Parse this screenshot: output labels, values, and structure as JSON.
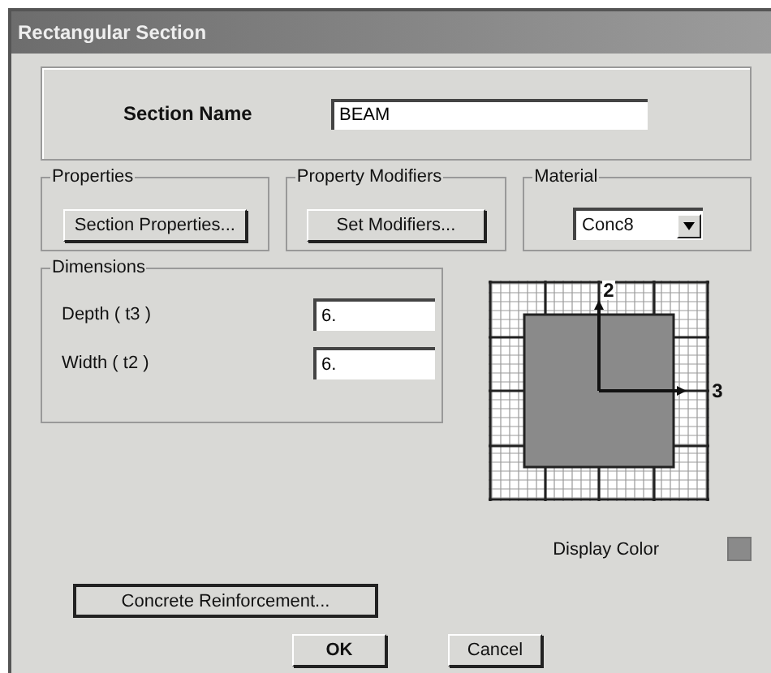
{
  "window": {
    "title": "Rectangular Section"
  },
  "section_name": {
    "label": "Section Name",
    "value": "BEAM"
  },
  "groups": [
    {
      "title": "Properties",
      "button": "Section Properties..."
    },
    {
      "title": "Property Modifiers",
      "button": "Set Modifiers..."
    }
  ],
  "material": {
    "title": "Material",
    "value": "Conc8"
  },
  "dimensions": {
    "title": "Dimensions",
    "fields": [
      {
        "label": "Depth ( t3 )",
        "value": "6."
      },
      {
        "label": "Width ( t2 )",
        "value": "6."
      }
    ]
  },
  "preview": {
    "axis_vertical": "2",
    "axis_horizontal": "3"
  },
  "display_color": {
    "label": "Display Color",
    "color": "#8a8a8a"
  },
  "reinforcement_button": "Concrete Reinforcement...",
  "buttons": [
    "OK",
    "Cancel"
  ]
}
